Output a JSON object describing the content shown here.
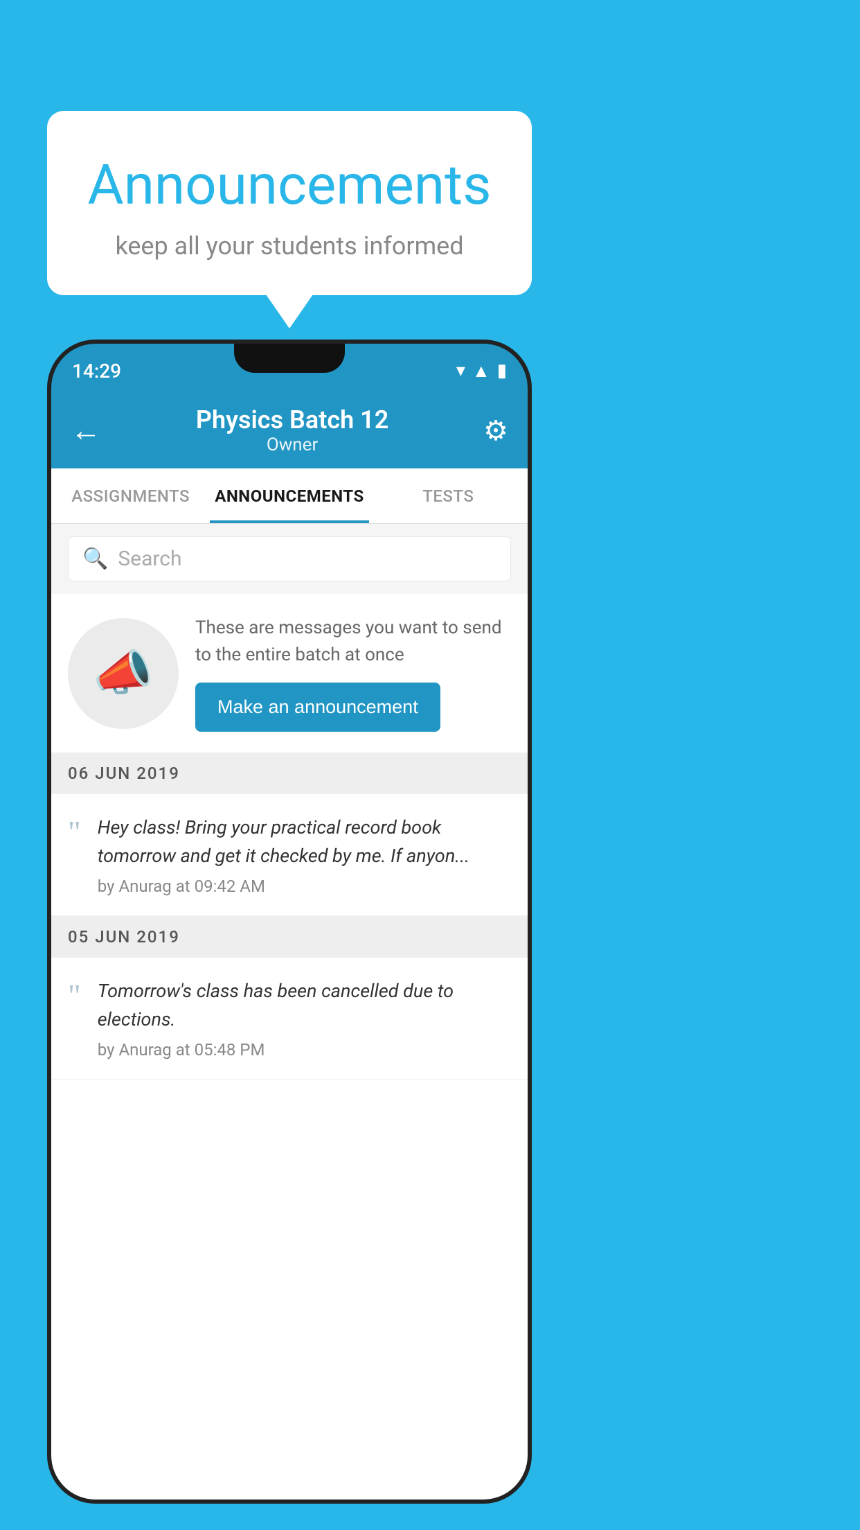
{
  "background_color": "#29b6e8",
  "bubble": {
    "title": "Announcements",
    "subtitle": "keep all your students informed"
  },
  "phone": {
    "status_bar": {
      "time": "14:29"
    },
    "app_bar": {
      "title": "Physics Batch 12",
      "subtitle": "Owner",
      "back_label": "←",
      "settings_label": "⚙"
    },
    "tabs": [
      {
        "label": "ASSIGNMENTS",
        "active": false
      },
      {
        "label": "ANNOUNCEMENTS",
        "active": true
      },
      {
        "label": "TESTS",
        "active": false
      }
    ],
    "search": {
      "placeholder": "Search"
    },
    "announcement_intro": {
      "description": "These are messages you want to send to the entire batch at once",
      "button_label": "Make an announcement"
    },
    "announcements": [
      {
        "date": "06  JUN  2019",
        "message": "Hey class! Bring your practical record book tomorrow and get it checked by me. If anyon...",
        "meta": "by Anurag at 09:42 AM"
      },
      {
        "date": "05  JUN  2019",
        "message": "Tomorrow's class has been cancelled due to elections.",
        "meta": "by Anurag at 05:48 PM"
      }
    ]
  }
}
